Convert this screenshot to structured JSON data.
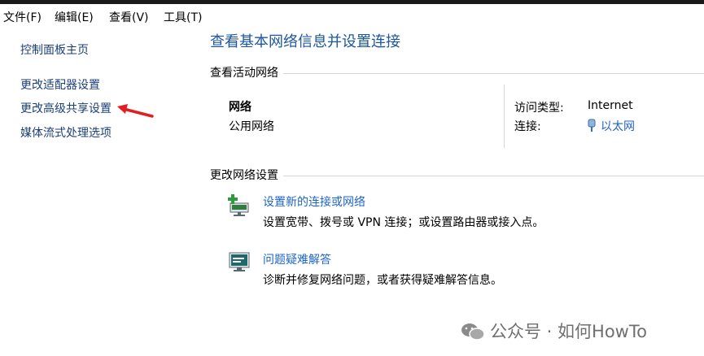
{
  "menubar": {
    "items": [
      "文件(F)",
      "编辑(E)",
      "查看(V)",
      "工具(T)"
    ]
  },
  "sidebar": {
    "items": [
      "控制面板主页",
      "更改适配器设置",
      "更改高级共享设置",
      "媒体流式处理选项"
    ],
    "highlighted_item": "更改高级共享设置"
  },
  "main": {
    "title": "查看基本网络信息并设置连接",
    "active_networks": {
      "heading": "查看活动网络",
      "network_name": "网络",
      "network_type": "公用网络",
      "access_type_label": "访问类型:",
      "access_type_value": "Internet",
      "connections_label": "连接:",
      "connections_value": "以太网"
    },
    "change_settings": {
      "heading": "更改网络设置",
      "tasks": [
        {
          "link": "设置新的连接或网络",
          "description": "设置宽带、拨号或 VPN 连接；或设置路由器或接入点。",
          "icon": "new-connection-icon"
        },
        {
          "link": "问题疑难解答",
          "description": "诊断并修复网络问题，或者获得疑难解答信息。",
          "icon": "troubleshoot-icon"
        }
      ]
    }
  },
  "watermark": {
    "text": "公众号 · 如何HowTo",
    "icon": "wechat-icon"
  },
  "colors": {
    "title_blue": "#1e56a0",
    "link_blue": "#1e64c8",
    "sidebar_link": "#1b3f7a",
    "arrow_red": "#e02020"
  }
}
